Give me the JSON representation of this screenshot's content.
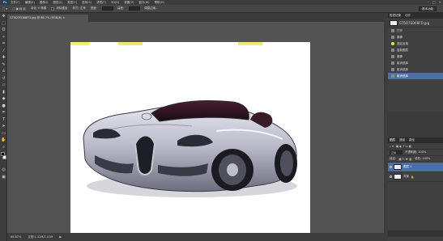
{
  "menubar": {
    "logo": "Ps",
    "items": [
      "文件(F)",
      "编辑(E)",
      "图像(I)",
      "图层(L)",
      "类型(Y)",
      "选择(S)",
      "滤镜(T)",
      "3D(D)",
      "视图(V)",
      "窗口(W)",
      "帮助(H)"
    ]
  },
  "optbar": {
    "items": [
      "羽化: 0 像素",
      "消除锯齿",
      "样式: 正常",
      "宽度:",
      "高度:",
      "调整边缘..."
    ],
    "workspace": "基本功能"
  },
  "document": {
    "tab_title": "GT5D7ED68FD.jpg @ 66.7% (RGB/8)"
  },
  "status": {
    "zoom": "66.67%",
    "doc_info": "文档:1.41M/1.41M"
  },
  "history_panel": {
    "tabs": [
      "历史记录",
      "动作"
    ],
    "snapshot_name": "GT5D7ED68FD.jpg",
    "entries": [
      {
        "label": "打开"
      },
      {
        "label": "魔棒"
      },
      {
        "label": "选区反相"
      },
      {
        "label": "复制图层"
      },
      {
        "label": "魔棒"
      },
      {
        "label": "取消选择"
      },
      {
        "label": "取消选择"
      },
      {
        "label": "取消选择"
      }
    ]
  },
  "layers_panel": {
    "tabs": [
      "图层",
      "通道",
      "路径"
    ],
    "mode": "正常",
    "opacity": "不透明度: 100%",
    "fill": "填充: 100%",
    "lock": "锁定:",
    "layers": [
      {
        "name": "图层 1"
      },
      {
        "name": "背景"
      }
    ]
  },
  "colors": {
    "selection_blue": "#4b6ea8",
    "history_marker": "#f7e52b"
  }
}
